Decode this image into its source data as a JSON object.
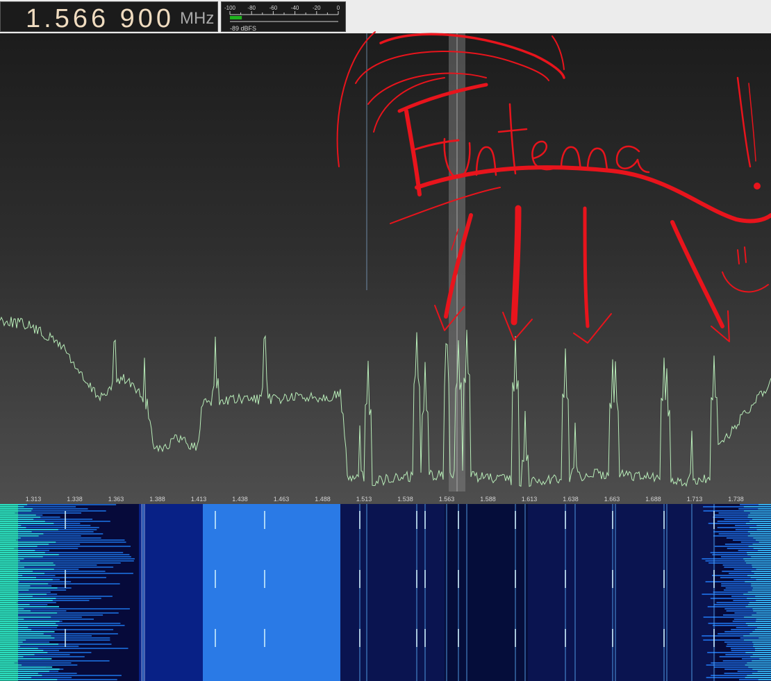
{
  "frequency": {
    "value": "1.566 900",
    "unit": "MHz"
  },
  "signal_meter": {
    "scale": [
      "-100",
      "-80",
      "-60",
      "-40",
      "-20",
      "0"
    ],
    "level_dbfs": -89,
    "readout": "-89 dBFS"
  },
  "spectrum": {
    "freq_axis_labels": [
      "1.313",
      "1.338",
      "1.363",
      "1.388",
      "1.413",
      "1.438",
      "1.463",
      "1.488",
      "1.513",
      "1.538",
      "1.563",
      "1.588",
      "1.613",
      "1.638",
      "1.663",
      "1.688",
      "1.713",
      "1.738"
    ],
    "tuned_frequency_label": "1.563",
    "trace_color": "#b8ecb8"
  },
  "annotation": {
    "text": "Funtenna!",
    "color": "#e8141c"
  },
  "waterfall": {
    "colors": {
      "background": "#060a3a",
      "band": "#2a7ae6",
      "hot": "#30f0a0"
    }
  },
  "colors": {
    "cursor_band": "#8a8a8a",
    "tick_text": "#d4d4d4"
  }
}
